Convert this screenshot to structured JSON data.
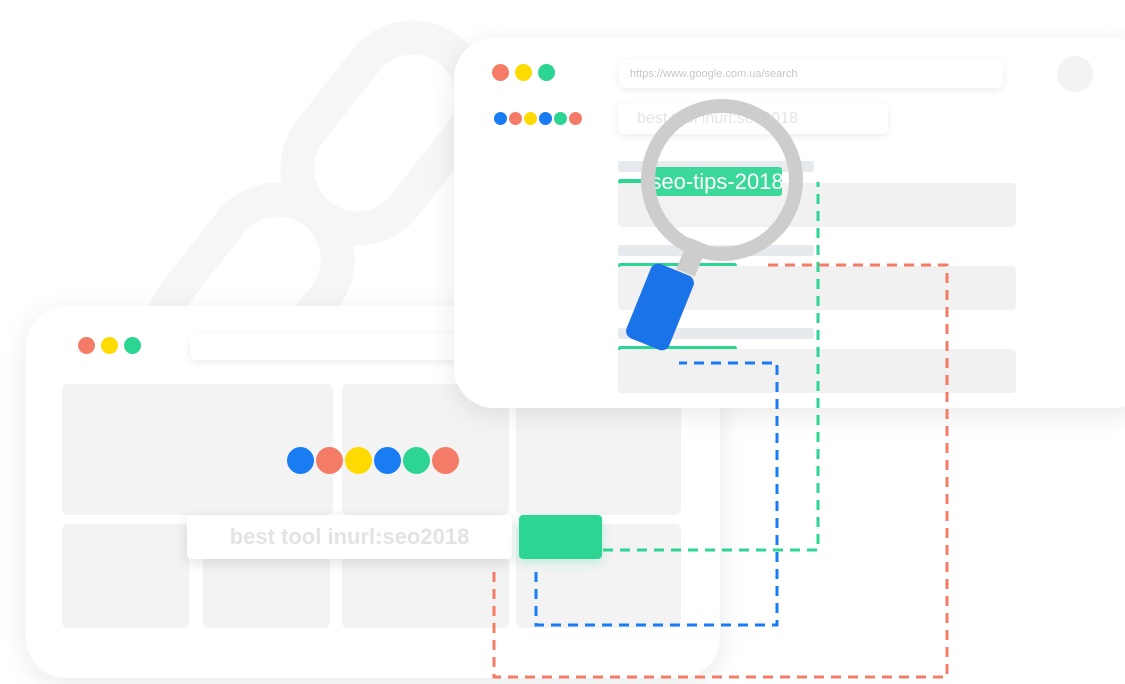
{
  "front_window": {
    "url": "https://www.google.com.ua/search",
    "query": "best tool inurl:seo2018",
    "highlighted_result": "seo-tips-2018"
  },
  "back_window": {
    "search_query": "best tool inurl:seo2018"
  },
  "icons": {
    "background": "chain-link-icon",
    "magnifier": "magnifying-glass-icon"
  },
  "colors": {
    "red": "#f47c67",
    "yellow": "#fedb00",
    "green": "#2cd592",
    "blue": "#1a7cf2",
    "magnifier_ring": "#cdcdcd",
    "magnifier_handle": "#1a73e8"
  }
}
